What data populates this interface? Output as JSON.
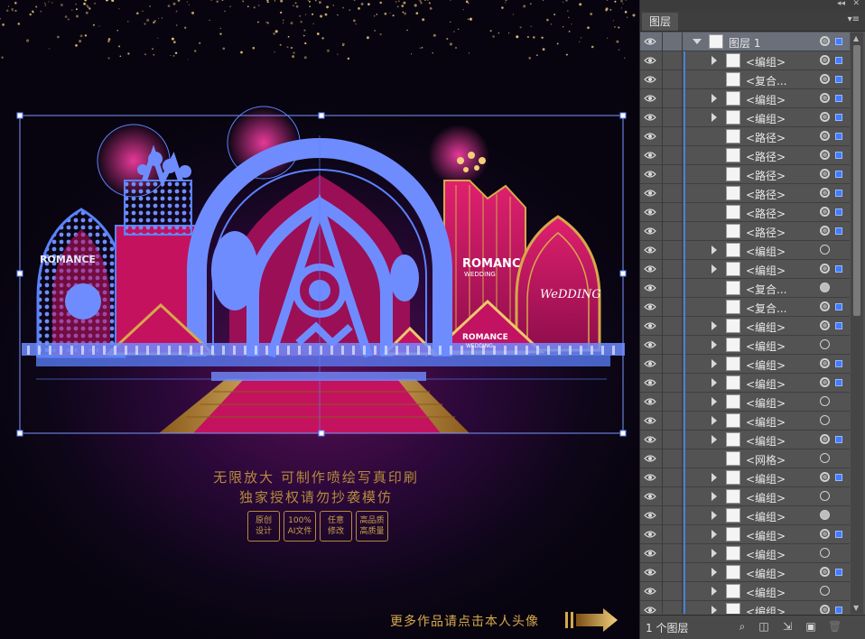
{
  "promo": {
    "line1": "无限放大 可制作喷绘写真印刷",
    "line2": "独家授权请勿抄袭模仿",
    "badges": [
      {
        "l1": "原创",
        "l2": "设计"
      },
      {
        "l1": "100%",
        "l2": "AI文件"
      },
      {
        "l1": "任意",
        "l2": "修改"
      },
      {
        "l1": "高品质",
        "l2": "高质量"
      }
    ],
    "more": "更多作品请点击本人头像"
  },
  "artwork": {
    "sign_center": "ROMANCE",
    "sign_center_sub": "WEDDING",
    "sign_low": "ROMANCE",
    "sign_low_sub": "WEDDING",
    "sign_right": "WeDDING",
    "sign_left": "ROMANCE"
  },
  "panel": {
    "tab": "图层",
    "layer_count": "1 个图层",
    "top_layer": "图层 1",
    "rows": [
      {
        "label": "<编组>",
        "expand": true,
        "target": "ring",
        "sel": true
      },
      {
        "label": "<复合...",
        "expand": false,
        "target": "ring",
        "sel": true
      },
      {
        "label": "<编组>",
        "expand": true,
        "target": "ring",
        "sel": true
      },
      {
        "label": "<编组>",
        "expand": true,
        "target": "ring",
        "sel": true
      },
      {
        "label": "<路径>",
        "expand": false,
        "target": "ring",
        "sel": true
      },
      {
        "label": "<路径>",
        "expand": false,
        "target": "ring",
        "sel": true
      },
      {
        "label": "<路径>",
        "expand": false,
        "target": "ring",
        "sel": true
      },
      {
        "label": "<路径>",
        "expand": false,
        "target": "ring",
        "sel": true
      },
      {
        "label": "<路径>",
        "expand": false,
        "target": "ring",
        "sel": true
      },
      {
        "label": "<路径>",
        "expand": false,
        "target": "ring",
        "sel": true
      },
      {
        "label": "<编组>",
        "expand": true,
        "target": "empty",
        "sel": false
      },
      {
        "label": "<编组>",
        "expand": true,
        "target": "ring",
        "sel": true
      },
      {
        "label": "<复合...",
        "expand": false,
        "target": "solid",
        "sel": false
      },
      {
        "label": "<复合...",
        "expand": false,
        "target": "ring",
        "sel": true
      },
      {
        "label": "<编组>",
        "expand": true,
        "target": "ring",
        "sel": true
      },
      {
        "label": "<编组>",
        "expand": true,
        "target": "empty",
        "sel": false
      },
      {
        "label": "<编组>",
        "expand": true,
        "target": "ring",
        "sel": true
      },
      {
        "label": "<编组>",
        "expand": true,
        "target": "ring",
        "sel": true
      },
      {
        "label": "<编组>",
        "expand": true,
        "target": "empty",
        "sel": false
      },
      {
        "label": "<编组>",
        "expand": true,
        "target": "empty",
        "sel": false
      },
      {
        "label": "<编组>",
        "expand": true,
        "target": "ring",
        "sel": true
      },
      {
        "label": "<网格>",
        "expand": false,
        "target": "empty",
        "sel": false
      },
      {
        "label": "<编组>",
        "expand": true,
        "target": "ring",
        "sel": true
      },
      {
        "label": "<编组>",
        "expand": true,
        "target": "empty",
        "sel": false
      },
      {
        "label": "<编组>",
        "expand": true,
        "target": "solid",
        "sel": false
      },
      {
        "label": "<编组>",
        "expand": true,
        "target": "ring",
        "sel": true
      },
      {
        "label": "<编组>",
        "expand": true,
        "target": "empty",
        "sel": false
      },
      {
        "label": "<编组>",
        "expand": true,
        "target": "ring",
        "sel": true
      },
      {
        "label": "<编组>",
        "expand": true,
        "target": "empty",
        "sel": false
      },
      {
        "label": "<编组>",
        "expand": true,
        "target": "ring",
        "sel": true
      }
    ]
  },
  "colors": {
    "selection": "#5b82ff",
    "gold": "#c9a24b",
    "magenta": "#c4125f"
  }
}
